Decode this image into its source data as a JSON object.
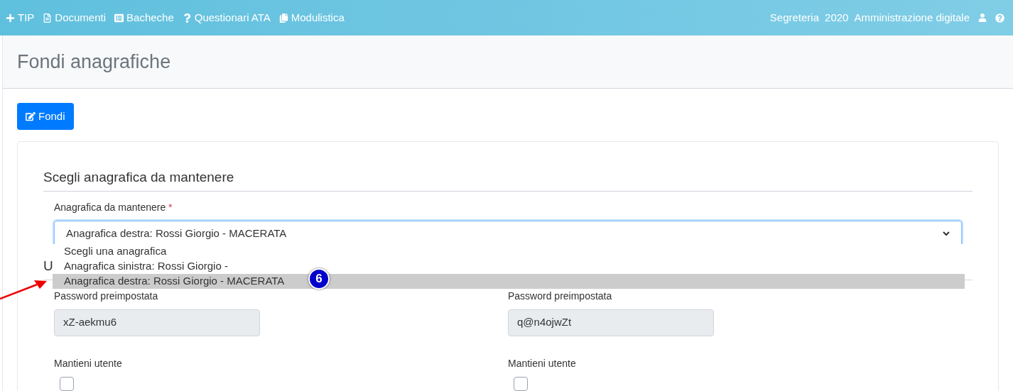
{
  "navbar": {
    "left_items": [
      {
        "kind": "plus",
        "label": "TIP"
      },
      {
        "kind": "document",
        "label": "Documenti"
      },
      {
        "kind": "board",
        "label": "Bacheche"
      },
      {
        "kind": "question",
        "label": "Questionari ATA"
      },
      {
        "kind": "forms",
        "label": "Modulistica"
      }
    ],
    "right_items": [
      "Segreteria",
      "2020",
      "Amministrazione digitale"
    ]
  },
  "page_title": "Fondi anagrafiche",
  "merge_button": "Fondi",
  "section": {
    "title": "Scegli anagrafica da mantenere",
    "field_label": "Anagrafica da mantenere",
    "required_mark": "*",
    "value": "Anagrafica destra: Rossi Giorgio - MACERATA",
    "options": [
      {
        "label": "Scegli una anagrafica",
        "selected": false
      },
      {
        "label": "Anagrafica sinistra: Rossi Giorgio -",
        "selected": false
      },
      {
        "label": "Anagrafica destra: Rossi Giorgio - MACERATA",
        "selected": true
      }
    ]
  },
  "annotation_badge": "6",
  "users_heading": "U",
  "columns": [
    {
      "password_label": "Password preimpostata",
      "password": "xZ-aekmu6",
      "keep_label": "Mantieni utente",
      "checked": false
    },
    {
      "password_label": "Password preimpostata",
      "password": "q@n4ojwZt",
      "keep_label": "Mantieni utente",
      "checked": false
    }
  ]
}
